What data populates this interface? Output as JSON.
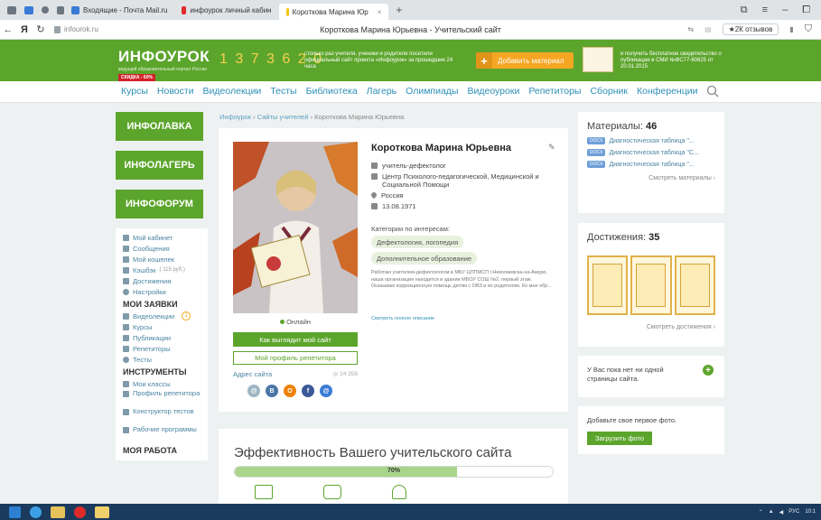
{
  "browser": {
    "tabs": [
      {
        "label": "Входящие - Почта Mail.ru",
        "color": "#3a7bd5"
      },
      {
        "label": "инфоурок личный кабин",
        "color": "#e02a2a"
      },
      {
        "label": "Короткова Марина Юр",
        "color": "#f5c518",
        "active": true
      }
    ],
    "new_tab": "+",
    "url": "infourok.ru",
    "page_title": "Короткова Марина Юрьевна - Учительский сайт",
    "reviews_label": "★2К отзывов",
    "icons": [
      "bookmarks-icon",
      "back-icon",
      "yandex-icon",
      "refresh-icon",
      "lock-icon"
    ]
  },
  "banner": {
    "logo": "ИНФОУРОК",
    "logo_sub": "ведущий образовательный портал России",
    "sale": "СКИДКА - 60%",
    "counter": "1 3 7 3 6 2 0",
    "counter_text": "столько раз учителя, ученики и родители посетили официальный сайт проекта «Инфоурок» за прошедшие 24 часа",
    "add_button": "Добавить материал",
    "add_plus": "+",
    "cert_text": "и получить бесплатное свидетельство о публикации в СМИ №ФС77-60625 от 20.01.2015",
    "accent": "#5ca52c"
  },
  "mainnav": {
    "items": [
      "Курсы",
      "Новости",
      "Видеолекции",
      "Тесты",
      "Библиотека",
      "Лагерь",
      "Олимпиады",
      "Видеоуроки",
      "Репетиторы",
      "Сборник",
      "Конференции"
    ]
  },
  "left": {
    "promos": [
      {
        "prefix": "ИНФО",
        "suffix": "ЛАВКА"
      },
      {
        "prefix": "ИНФО",
        "suffix": "ЛАГЕРЬ"
      },
      {
        "prefix": "ИНФО",
        "suffix": "ФОРУМ"
      }
    ],
    "menu": [
      {
        "label": "Мой кабинет"
      },
      {
        "label": "Сообщения"
      },
      {
        "label": "Мой кошелек"
      },
      {
        "label": "Кэшбэк",
        "sub": "( 115 руб.)"
      },
      {
        "label": "Достижения"
      },
      {
        "label": "Настройки"
      }
    ],
    "heading_orders": "МОИ ЗАЯВКИ",
    "orders": [
      {
        "label": "Видеолекции",
        "badge": "1"
      },
      {
        "label": "Курсы"
      },
      {
        "label": "Публикации"
      },
      {
        "label": "Репетиторы"
      },
      {
        "label": "Тесты"
      }
    ],
    "heading_tools": "ИНСТРУМЕНТЫ",
    "tools": [
      {
        "label": "Мои классы"
      },
      {
        "label": "Профиль репетитора"
      },
      {
        "label": "Конструктор тестов"
      },
      {
        "label": "Рабочие программы"
      }
    ],
    "heading_work": "МОЯ РАБОТА"
  },
  "breadcrumb": {
    "home": "Инфоурок",
    "sep": " › ",
    "section": "Сайты учителей",
    "current": "Короткова Марина Юрьевна"
  },
  "profile": {
    "name": "Короткова Марина Юрьевна",
    "role": "учитель-дефектолог",
    "org": "Центр Психолого-педагогической, Медицинской и Социальной Помощи",
    "country": "Россия",
    "birthdate": "13.08.1971",
    "interests_label": "Категории по интересам:",
    "tags": [
      "Дефектология, логопедия",
      "Дополнительное образование"
    ],
    "about": "Работаю учителем-дефектологом в МБУ ЦППМСП г.Николаевска-на-Амуре, наша организация находится в здании МБОУ СОШ №2, первый этаж. Оказываю коррекционную помощь детям с ОВЗ и их родителям. Ко мне обр...",
    "about_more": "Смотреть полное описание",
    "online": "Онлайн",
    "btn_site": "Как выглядит мой сайт",
    "btn_tutor": "Мой профиль репетитора",
    "site_label": "Адрес сайта",
    "views": "◎ 24 356",
    "socials": [
      {
        "name": "odnoklassniki-icon",
        "color": "#9fb6c4",
        "glyph": "@"
      },
      {
        "name": "vk-icon",
        "color": "#4a76a8",
        "glyph": "В"
      },
      {
        "name": "ok-icon",
        "color": "#ee8208",
        "glyph": "О"
      },
      {
        "name": "facebook-icon",
        "color": "#3b5998",
        "glyph": "f"
      },
      {
        "name": "mailru-icon",
        "color": "#3a7bd5",
        "glyph": "@"
      }
    ]
  },
  "efficiency": {
    "title": "Эффективность Вашего учительского сайта",
    "percent_label": "70%",
    "percent": 70
  },
  "right": {
    "materials_label": "Материалы:",
    "materials_count": "46",
    "materials": [
      {
        "badge": "DOCX",
        "label": "Диагностическая таблица \"..."
      },
      {
        "badge": "DOCX",
        "label": "Диагностическая таблица \"С..."
      },
      {
        "badge": "DOCX",
        "label": "Диагностическая таблица \"..."
      }
    ],
    "materials_link": "Смотреть материалы ›",
    "achievements_label": "Достижения:",
    "achievements_count": "35",
    "achievements_link": "Смотреть достижения ›",
    "pages_text": "У Вас пока нет ни одной страницы сайта.",
    "photo_text": "Добавьте свое первое фото.",
    "upload_btn": "Загрузить фото"
  },
  "taskbar": {
    "lang": "РУС",
    "time": "10:1"
  }
}
